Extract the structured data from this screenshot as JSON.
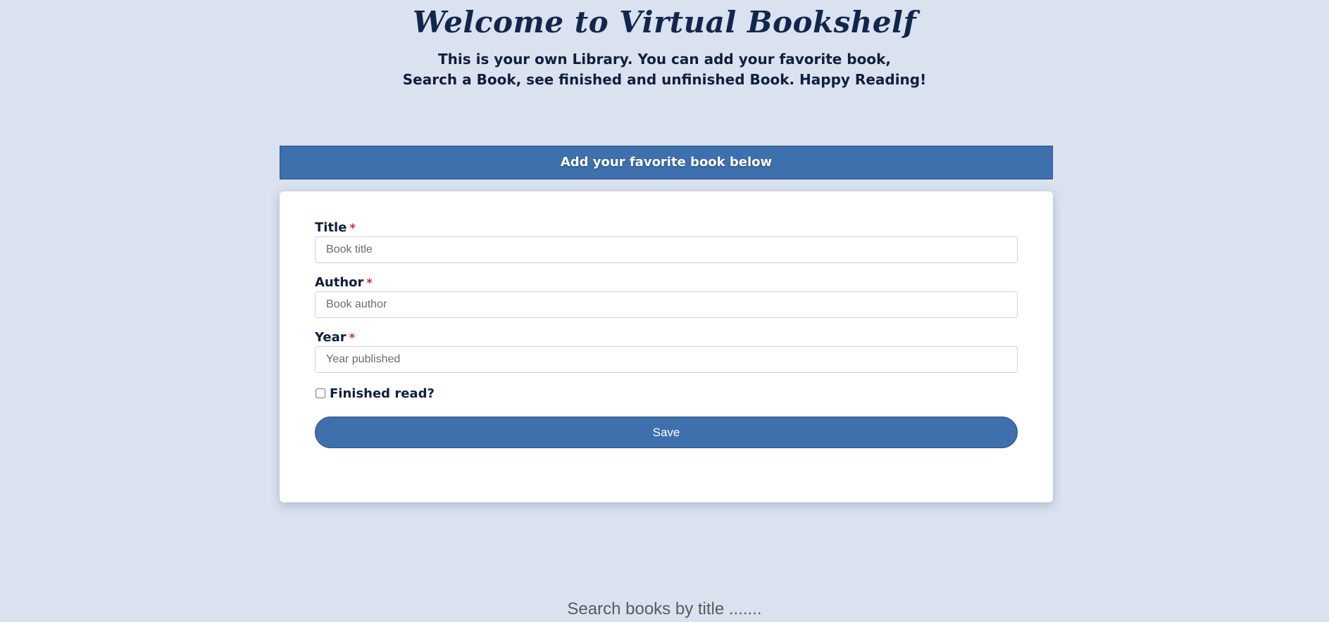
{
  "hero": {
    "title": "Welcome to Virtual Bookshelf",
    "subtitle_line1": "This is your own Library. You can add your favorite book,",
    "subtitle_line2": "Search a Book, see finished and unfinished Book. Happy Reading!"
  },
  "form": {
    "header": "Add your favorite book below",
    "required_marker": "*",
    "title_label": "Title",
    "title_placeholder": "Book title",
    "author_label": "Author",
    "author_placeholder": "Book author",
    "year_label": "Year",
    "year_placeholder": "Year published",
    "finished_label": "Finished read?",
    "finished_checked": false,
    "save_label": "Save"
  },
  "search": {
    "placeholder": "Search books by title ......."
  },
  "colors": {
    "background": "#dae2ef",
    "accent": "#3e70ad",
    "required": "#e02424",
    "text": "#0f1f3d"
  }
}
